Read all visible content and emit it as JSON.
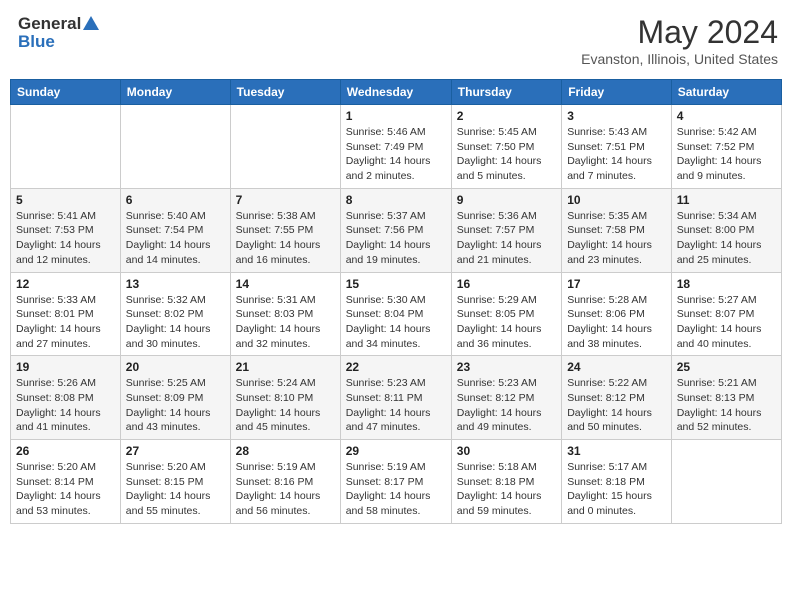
{
  "header": {
    "logo_general": "General",
    "logo_blue": "Blue",
    "title": "May 2024",
    "subtitle": "Evanston, Illinois, United States"
  },
  "days_of_week": [
    "Sunday",
    "Monday",
    "Tuesday",
    "Wednesday",
    "Thursday",
    "Friday",
    "Saturday"
  ],
  "weeks": [
    [
      {
        "day": "",
        "sunrise": "",
        "sunset": "",
        "daylight": ""
      },
      {
        "day": "",
        "sunrise": "",
        "sunset": "",
        "daylight": ""
      },
      {
        "day": "",
        "sunrise": "",
        "sunset": "",
        "daylight": ""
      },
      {
        "day": "1",
        "sunrise": "Sunrise: 5:46 AM",
        "sunset": "Sunset: 7:49 PM",
        "daylight": "Daylight: 14 hours and 2 minutes."
      },
      {
        "day": "2",
        "sunrise": "Sunrise: 5:45 AM",
        "sunset": "Sunset: 7:50 PM",
        "daylight": "Daylight: 14 hours and 5 minutes."
      },
      {
        "day": "3",
        "sunrise": "Sunrise: 5:43 AM",
        "sunset": "Sunset: 7:51 PM",
        "daylight": "Daylight: 14 hours and 7 minutes."
      },
      {
        "day": "4",
        "sunrise": "Sunrise: 5:42 AM",
        "sunset": "Sunset: 7:52 PM",
        "daylight": "Daylight: 14 hours and 9 minutes."
      }
    ],
    [
      {
        "day": "5",
        "sunrise": "Sunrise: 5:41 AM",
        "sunset": "Sunset: 7:53 PM",
        "daylight": "Daylight: 14 hours and 12 minutes."
      },
      {
        "day": "6",
        "sunrise": "Sunrise: 5:40 AM",
        "sunset": "Sunset: 7:54 PM",
        "daylight": "Daylight: 14 hours and 14 minutes."
      },
      {
        "day": "7",
        "sunrise": "Sunrise: 5:38 AM",
        "sunset": "Sunset: 7:55 PM",
        "daylight": "Daylight: 14 hours and 16 minutes."
      },
      {
        "day": "8",
        "sunrise": "Sunrise: 5:37 AM",
        "sunset": "Sunset: 7:56 PM",
        "daylight": "Daylight: 14 hours and 19 minutes."
      },
      {
        "day": "9",
        "sunrise": "Sunrise: 5:36 AM",
        "sunset": "Sunset: 7:57 PM",
        "daylight": "Daylight: 14 hours and 21 minutes."
      },
      {
        "day": "10",
        "sunrise": "Sunrise: 5:35 AM",
        "sunset": "Sunset: 7:58 PM",
        "daylight": "Daylight: 14 hours and 23 minutes."
      },
      {
        "day": "11",
        "sunrise": "Sunrise: 5:34 AM",
        "sunset": "Sunset: 8:00 PM",
        "daylight": "Daylight: 14 hours and 25 minutes."
      }
    ],
    [
      {
        "day": "12",
        "sunrise": "Sunrise: 5:33 AM",
        "sunset": "Sunset: 8:01 PM",
        "daylight": "Daylight: 14 hours and 27 minutes."
      },
      {
        "day": "13",
        "sunrise": "Sunrise: 5:32 AM",
        "sunset": "Sunset: 8:02 PM",
        "daylight": "Daylight: 14 hours and 30 minutes."
      },
      {
        "day": "14",
        "sunrise": "Sunrise: 5:31 AM",
        "sunset": "Sunset: 8:03 PM",
        "daylight": "Daylight: 14 hours and 32 minutes."
      },
      {
        "day": "15",
        "sunrise": "Sunrise: 5:30 AM",
        "sunset": "Sunset: 8:04 PM",
        "daylight": "Daylight: 14 hours and 34 minutes."
      },
      {
        "day": "16",
        "sunrise": "Sunrise: 5:29 AM",
        "sunset": "Sunset: 8:05 PM",
        "daylight": "Daylight: 14 hours and 36 minutes."
      },
      {
        "day": "17",
        "sunrise": "Sunrise: 5:28 AM",
        "sunset": "Sunset: 8:06 PM",
        "daylight": "Daylight: 14 hours and 38 minutes."
      },
      {
        "day": "18",
        "sunrise": "Sunrise: 5:27 AM",
        "sunset": "Sunset: 8:07 PM",
        "daylight": "Daylight: 14 hours and 40 minutes."
      }
    ],
    [
      {
        "day": "19",
        "sunrise": "Sunrise: 5:26 AM",
        "sunset": "Sunset: 8:08 PM",
        "daylight": "Daylight: 14 hours and 41 minutes."
      },
      {
        "day": "20",
        "sunrise": "Sunrise: 5:25 AM",
        "sunset": "Sunset: 8:09 PM",
        "daylight": "Daylight: 14 hours and 43 minutes."
      },
      {
        "day": "21",
        "sunrise": "Sunrise: 5:24 AM",
        "sunset": "Sunset: 8:10 PM",
        "daylight": "Daylight: 14 hours and 45 minutes."
      },
      {
        "day": "22",
        "sunrise": "Sunrise: 5:23 AM",
        "sunset": "Sunset: 8:11 PM",
        "daylight": "Daylight: 14 hours and 47 minutes."
      },
      {
        "day": "23",
        "sunrise": "Sunrise: 5:23 AM",
        "sunset": "Sunset: 8:12 PM",
        "daylight": "Daylight: 14 hours and 49 minutes."
      },
      {
        "day": "24",
        "sunrise": "Sunrise: 5:22 AM",
        "sunset": "Sunset: 8:12 PM",
        "daylight": "Daylight: 14 hours and 50 minutes."
      },
      {
        "day": "25",
        "sunrise": "Sunrise: 5:21 AM",
        "sunset": "Sunset: 8:13 PM",
        "daylight": "Daylight: 14 hours and 52 minutes."
      }
    ],
    [
      {
        "day": "26",
        "sunrise": "Sunrise: 5:20 AM",
        "sunset": "Sunset: 8:14 PM",
        "daylight": "Daylight: 14 hours and 53 minutes."
      },
      {
        "day": "27",
        "sunrise": "Sunrise: 5:20 AM",
        "sunset": "Sunset: 8:15 PM",
        "daylight": "Daylight: 14 hours and 55 minutes."
      },
      {
        "day": "28",
        "sunrise": "Sunrise: 5:19 AM",
        "sunset": "Sunset: 8:16 PM",
        "daylight": "Daylight: 14 hours and 56 minutes."
      },
      {
        "day": "29",
        "sunrise": "Sunrise: 5:19 AM",
        "sunset": "Sunset: 8:17 PM",
        "daylight": "Daylight: 14 hours and 58 minutes."
      },
      {
        "day": "30",
        "sunrise": "Sunrise: 5:18 AM",
        "sunset": "Sunset: 8:18 PM",
        "daylight": "Daylight: 14 hours and 59 minutes."
      },
      {
        "day": "31",
        "sunrise": "Sunrise: 5:17 AM",
        "sunset": "Sunset: 8:18 PM",
        "daylight": "Daylight: 15 hours and 0 minutes."
      },
      {
        "day": "",
        "sunrise": "",
        "sunset": "",
        "daylight": ""
      }
    ]
  ]
}
